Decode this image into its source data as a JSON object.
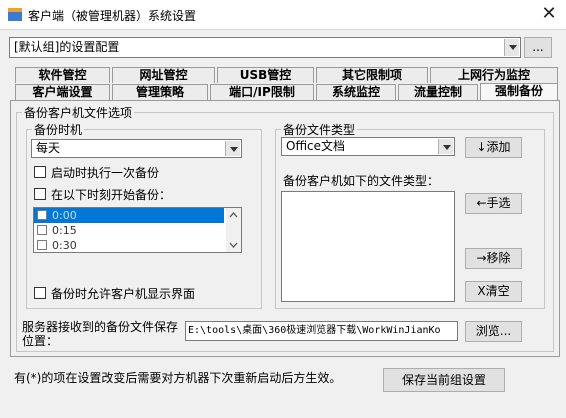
{
  "window": {
    "title": "客户端（被管理机器）系统设置",
    "close_glyph": "✕"
  },
  "group_config": {
    "value": "[默认组]的设置配置",
    "more_label": "..."
  },
  "tabs_row1": [
    "软件管控",
    "网址管控",
    "USB管控",
    "其它限制项",
    "上网行为监控"
  ],
  "tabs_row2": [
    "客户端设置",
    "管理策略",
    "端口/IP限制",
    "系统监控",
    "流量控制",
    "强制备份"
  ],
  "active_tab": "强制备份",
  "backup_options": {
    "legend": "备份客户机文件选项",
    "time_group": {
      "legend": "备份时机",
      "frequency": "每天",
      "check_startup": "启动时执行一次备份",
      "check_schedule": "在以下时刻开始备份：",
      "times": [
        "0:00",
        "0:15",
        "0:30"
      ],
      "check_show_ui": "备份时允许客户机显示界面"
    },
    "type_group": {
      "legend": "备份文件类型",
      "file_type": "Office文档",
      "add_label": "↓添加",
      "list_label": "备份客户机如下的文件类型：",
      "manual_label": "←手选",
      "remove_label": "→移除",
      "clear_label": "X清空"
    },
    "server_path": {
      "label": "服务器接收到的备份文件保存位置：",
      "value": "E:\\tools\\桌面\\360极速浏览器下载\\WorkWinJianKo",
      "browse_label": "浏览..."
    }
  },
  "footer": {
    "note": "有(*)的项在设置改变后需要对方机器下次重新启动后方生效。",
    "save_label": "保存当前组设置"
  },
  "colors": {
    "selection": "#0078d7",
    "background": "#f0f0f0"
  }
}
